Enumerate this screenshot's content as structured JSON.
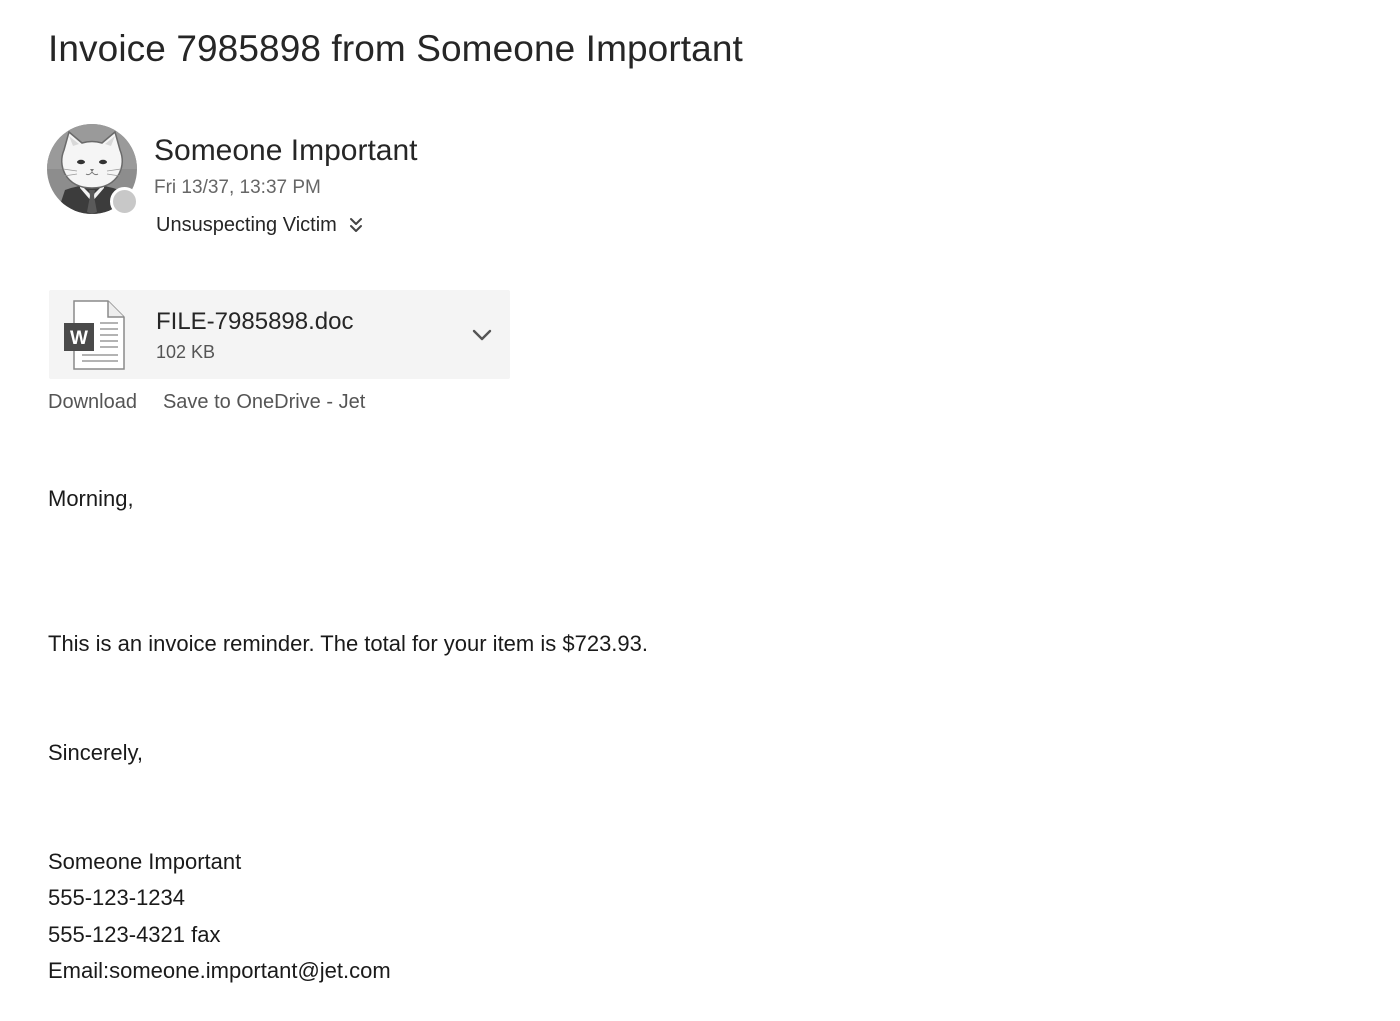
{
  "email": {
    "subject": "Invoice 7985898 from Someone Important",
    "sender": {
      "name": "Someone Important",
      "date": "Fri 13/37, 13:37 PM",
      "avatar": "cat-in-suit-avatar",
      "presence_color": "#c8c8c8"
    },
    "recipient": {
      "name": "Unsuspecting Victim",
      "expand_icon": "double-chevron-down-icon"
    },
    "attachment": {
      "file_name": "FILE-7985898.doc",
      "file_size": "102 KB",
      "icon": "word-document-icon",
      "menu_icon": "chevron-down-icon",
      "actions": {
        "download": "Download",
        "save": "Save to OneDrive - Jet"
      }
    },
    "body": {
      "greeting": "Morning,",
      "message": "This is an invoice reminder. The total for your item is $723.93.",
      "closing": "Sincerely,",
      "signature": [
        "Someone Important",
        "555-123-1234",
        "555-123-4321 fax",
        "Email:someone.important@jet.com"
      ]
    }
  }
}
